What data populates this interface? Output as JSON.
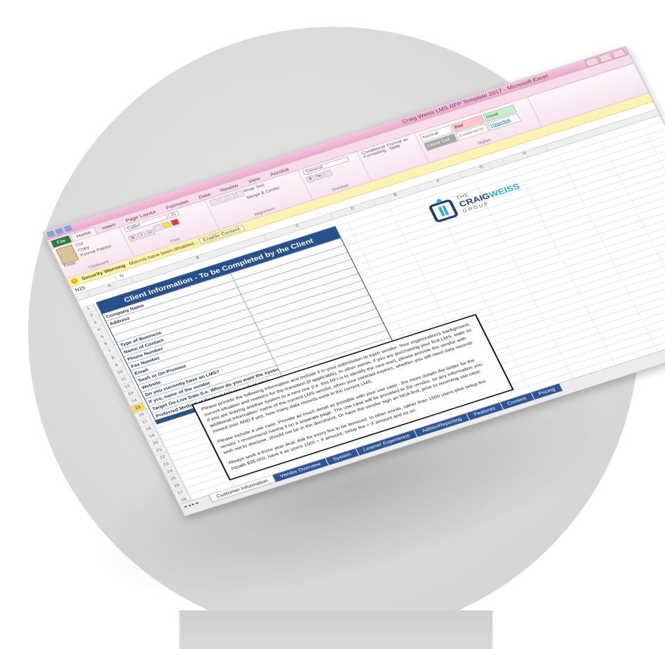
{
  "window": {
    "title": "Craig Weiss LMS RFP Template 2017 - Microsoft Excel"
  },
  "ribbon": {
    "tabs": [
      "File",
      "Home",
      "Insert",
      "Page Layout",
      "Formulas",
      "Data",
      "Review",
      "View",
      "Acrobat"
    ],
    "clipboard": {
      "paste": "Paste",
      "cut": "Cut",
      "copy": "Copy",
      "format_painter": "Format Painter",
      "group": "Clipboard"
    },
    "font": {
      "name": "Calibri",
      "size": "11",
      "group": "Font"
    },
    "alignment": {
      "wrap": "Wrap Text",
      "merge": "Merge & Center",
      "group": "Alignment"
    },
    "number": {
      "format": "General",
      "group": "Number"
    },
    "styles": {
      "conditional": "Conditional Formatting",
      "table": "Format as Table",
      "cells": [
        "Normal",
        "Bad",
        "Good",
        "Check Cell",
        "Explanatory ...",
        "Hyperlink"
      ],
      "group": "Styles"
    }
  },
  "security": {
    "label": "Security Warning",
    "message": "Macros have been disabled.",
    "button": "Enable Content"
  },
  "formula_bar": {
    "name_box": "N15",
    "fx": "fx"
  },
  "row_numbers": [
    "1",
    "2",
    "3",
    "4",
    "5",
    "6",
    "7",
    "8",
    "9",
    "10",
    "11",
    "12",
    "13",
    "14",
    "15",
    "16",
    "17",
    "18",
    "19",
    "20",
    "21",
    "22",
    "23",
    "24",
    "25",
    "26",
    "27",
    "28",
    "29",
    "30",
    "31",
    "32",
    "33",
    "34",
    "35",
    "36",
    "37",
    "38"
  ],
  "form": {
    "header": "Client Information - To be Completed by the Client",
    "fields": [
      "Company Name",
      "Address",
      "",
      "",
      "Type of Business",
      "Name of Contact",
      "Phone Number",
      "Fax Number",
      "Email",
      "SaaS or On-Premise",
      "Website",
      "Do you currently have an LMS?",
      "If yes, name of the vendor",
      "Target Go-Live Date (i.e. When do you want the system up and running with learners?)",
      "Preferred Method of Contact (please select one)"
    ]
  },
  "instructions": {
    "p1": "Please provide the following information and include it in your submission to each vendor: Your organization's background, current situation and reasons for the transition (if applicable). In other words, if you are purchasing your first LMS, state so. If you are leaving another system to a new one (i.e. this RFI is to identify the new one), please provide the vendor with additional information: name of the current LMS vendor, when your contract expires, whether you will need data records moved over AND if yes, how many data records exist in the current LMS.",
    "p2": "Please include a use case. Provide as much detail as possible with your use case - the more details the better for the vendor. I recommend having it on a separate page. The use case will be provided to the vendor, so any information you wish not to disclose, should not be in the document. Or have the vendor sign an NDA first, prior to receiving use case.",
    "p3": "Always seek a three year deal. Ask for every fee to be itemized. In other words, rather than 1500 users plus setup fee equals $35,000, have it as users 1500 = X amount, setup fee = X amount and so on."
  },
  "logo": {
    "the": "THE",
    "craig": "CRAIG",
    "weiss": "WEISS",
    "group": "GROUP"
  },
  "sheets": [
    "Customer Information",
    "Vendor Overview",
    "System",
    "Learner Experience",
    "Admin/Reporting",
    "Features",
    "Content",
    "Pricing"
  ]
}
